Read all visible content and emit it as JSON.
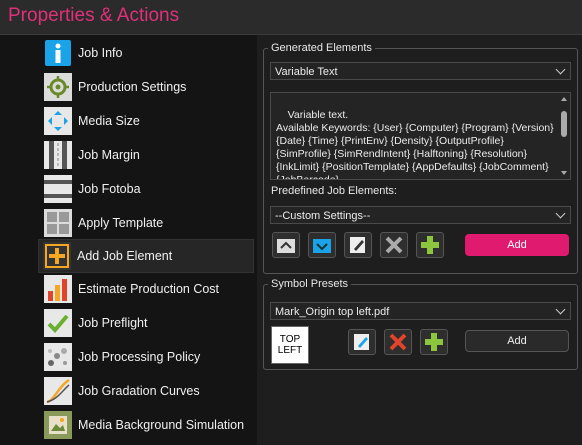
{
  "window": {
    "title": "Properties & Actions"
  },
  "sidebar": {
    "items": [
      {
        "label": "Job Info",
        "icon": "info-icon"
      },
      {
        "label": "Production Settings",
        "icon": "gear-icon"
      },
      {
        "label": "Media Size",
        "icon": "media-size-icon"
      },
      {
        "label": "Job Margin",
        "icon": "margin-icon"
      },
      {
        "label": "Job Fotoba",
        "icon": "fotoba-icon"
      },
      {
        "label": "Apply Template",
        "icon": "template-grid-icon"
      },
      {
        "label": "Add Job Element",
        "icon": "add-element-icon",
        "selected": true
      },
      {
        "label": "Estimate Production Cost",
        "icon": "cost-chart-icon"
      },
      {
        "label": "Job Preflight",
        "icon": "checkmark-icon"
      },
      {
        "label": "Job Processing Policy",
        "icon": "policy-dots-icon"
      },
      {
        "label": "Job Gradation Curves",
        "icon": "curves-icon"
      },
      {
        "label": "Media Background Simulation",
        "icon": "background-image-icon"
      }
    ]
  },
  "generated": {
    "legend": "Generated Elements",
    "type_select": "Variable Text",
    "text_content": "Variable text.\nAvailable Keywords: {User} {Computer} {Program} {Version} {Date} {Time} {PrintEnv} {Density} {OutputProfile} {SimProfile} {SimRendIntent} {Halftoning} {Resolution} {InkLimit} {PositionTemplate} {AppDefaults} {JobComment} {JobBarcode}",
    "predefined_label": "Predefined Job Elements:",
    "predefined_select": "--Custom Settings--",
    "add_label": "Add"
  },
  "symbols": {
    "legend": "Symbol Presets",
    "preset_select": "Mark_Origin top left.pdf",
    "preview_line1": "TOP",
    "preview_line2": "LEFT",
    "add_label": "Add"
  },
  "colors": {
    "accent": "#e0307a",
    "add_button": "#e01a6e",
    "plus_green": "#8cc63f",
    "delete_red": "#e0442a"
  }
}
